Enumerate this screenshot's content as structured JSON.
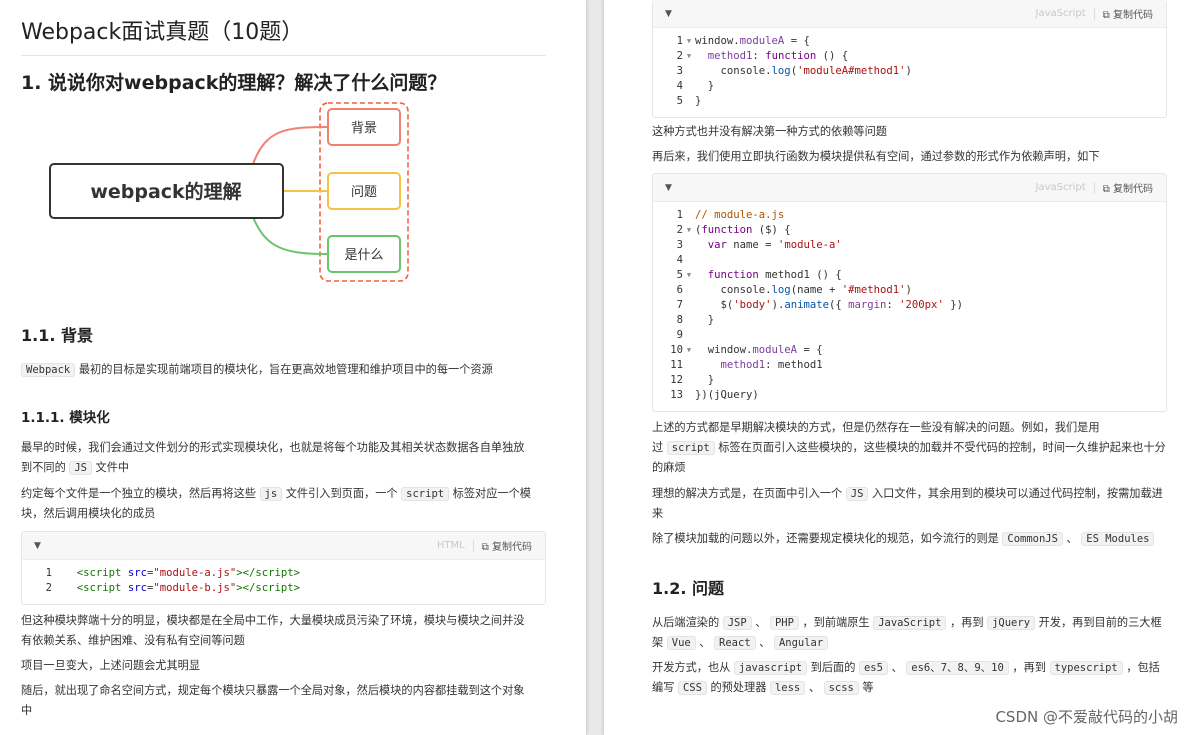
{
  "left": {
    "doc_title": "Webpack面试真题（10题）",
    "q1_title": "1. 说说你对webpack的理解？解决了什么问题？",
    "mindmap": {
      "center": "webpack的理解",
      "branches": [
        "背景",
        "问题",
        "是什么"
      ],
      "colors": {
        "bg": "#f08070",
        "problem": "#f5c342",
        "what": "#6cc46c",
        "dashed": "#f06040"
      }
    },
    "h_background": "1.1. 背景",
    "bg_text_code": "Webpack",
    "bg_text": " 最初的目标是实现前端项目的模块化，旨在更高效地管理和维护项目中的每一个资源",
    "h_modular": "1.1.1. 模块化",
    "p1a": "最早的时候，我们会通过文件划分的形式实现模块化，也就是将每个功能及其相关状态数据各自单独放",
    "p1b_pre": "到不同的 ",
    "p1b_code": "JS",
    "p1b_post": " 文件中",
    "p2a_pre": "约定每个文件是一个独立的模块，然后再将这些 ",
    "p2a_code1": "js",
    "p2a_mid": " 文件引入到页面，一个 ",
    "p2a_code2": "script",
    "p2a_post": " 标签对应一个模",
    "p2b": "块，然后调用模块化的成员",
    "code1": {
      "lang": "HTML",
      "copy": "复制代码"
    },
    "p3a": "但这种模块弊端十分的明显，模块都是在全局中工作，大量模块成员污染了环境，模块与模块之间并没",
    "p3b": "有依赖关系、维护困难、没有私有空间等问题",
    "p4": "项目一旦变大，上述问题会尤其明显",
    "p5a": "随后，就出现了命名空间方式，规定每个模块只暴露一个全局对象，然后模块的内容都挂载到这个对象",
    "p5b": "中"
  },
  "right": {
    "code2": {
      "lang": "JavaScript",
      "copy": "复制代码"
    },
    "r1": "这种方式也并没有解决第一种方式的依赖等问题",
    "r2": "再后来，我们使用立即执行函数为模块提供私有空间，通过参数的形式作为依赖声明，如下",
    "code3": {
      "lang": "JavaScript",
      "copy": "复制代码"
    },
    "r3a": "上述的方式都是早期解决模块的方式，但是仍然存在一些没有解决的问题。例如，我们是用",
    "r3b_pre": "过 ",
    "r3b_code": "script",
    "r3b_post": " 标签在页面引入这些模块的，这些模块的加载并不受代码的控制，时间一久维护起来也十分",
    "r3c": "的麻烦",
    "r4a_pre": "理想的解决方式是，在页面中引入一个 ",
    "r4a_code": "JS",
    "r4a_post": " 入口文件，其余用到的模块可以通过代码控制，按需加载进",
    "r4b": "来",
    "r5_pre": "除了模块加载的问题以外，还需要规定模块化的规范，如今流行的则是 ",
    "r5_code1": "CommonJS",
    "r5_mid": " 、 ",
    "r5_code2": "ES Modules",
    "h_problem": "1.2. 问题",
    "r6a": {
      "t1": "从后端渲染的 ",
      "c1": "JSP",
      "t2": " 、 ",
      "c2": "PHP",
      "t3": " ，到前端原生 ",
      "c3": "JavaScript",
      "t4": " ，再到 ",
      "c4": "jQuery",
      "t5": " 开发，再到目前的三大框"
    },
    "r6b": {
      "t1": "架 ",
      "c1": "Vue",
      "t2": " 、 ",
      "c2": "React",
      "t3": " 、 ",
      "c3": "Angular"
    },
    "r7a": {
      "t1": "开发方式，也从 ",
      "c1": "javascript",
      "t2": " 到后面的 ",
      "c2": "es5",
      "t3": " 、 ",
      "c3": "es6、7、8、9、10",
      "t4": " ，再到 ",
      "c4": "typescript",
      "t5": " ，包括"
    },
    "r7b": {
      "t1": "编写 ",
      "c1": "CSS",
      "t2": " 的预处理器 ",
      "c2": "less",
      "t3": " 、 ",
      "c3": "scss",
      "t4": " 等"
    }
  },
  "watermark": "CSDN @不爱敲代码的小胡"
}
